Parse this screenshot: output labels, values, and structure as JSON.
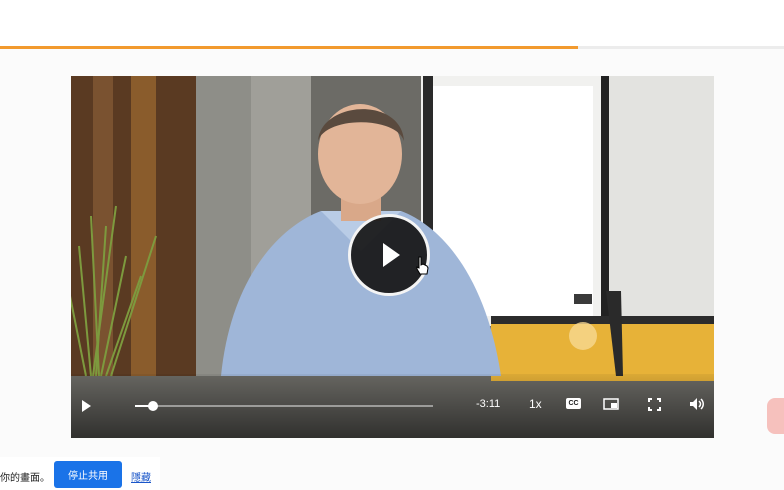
{
  "page": {
    "progress_percent": 73.7
  },
  "video": {
    "time_remaining": "-3:11",
    "speed": "1x",
    "cc_label": "CC",
    "seek_fraction": 0.06
  },
  "share_bar": {
    "message": "你的畫面。",
    "stop_label": "停止共用",
    "hide_label": "隱藏"
  },
  "colors": {
    "accent_orange": "#f29a2e",
    "button_blue": "#1a73e8"
  }
}
